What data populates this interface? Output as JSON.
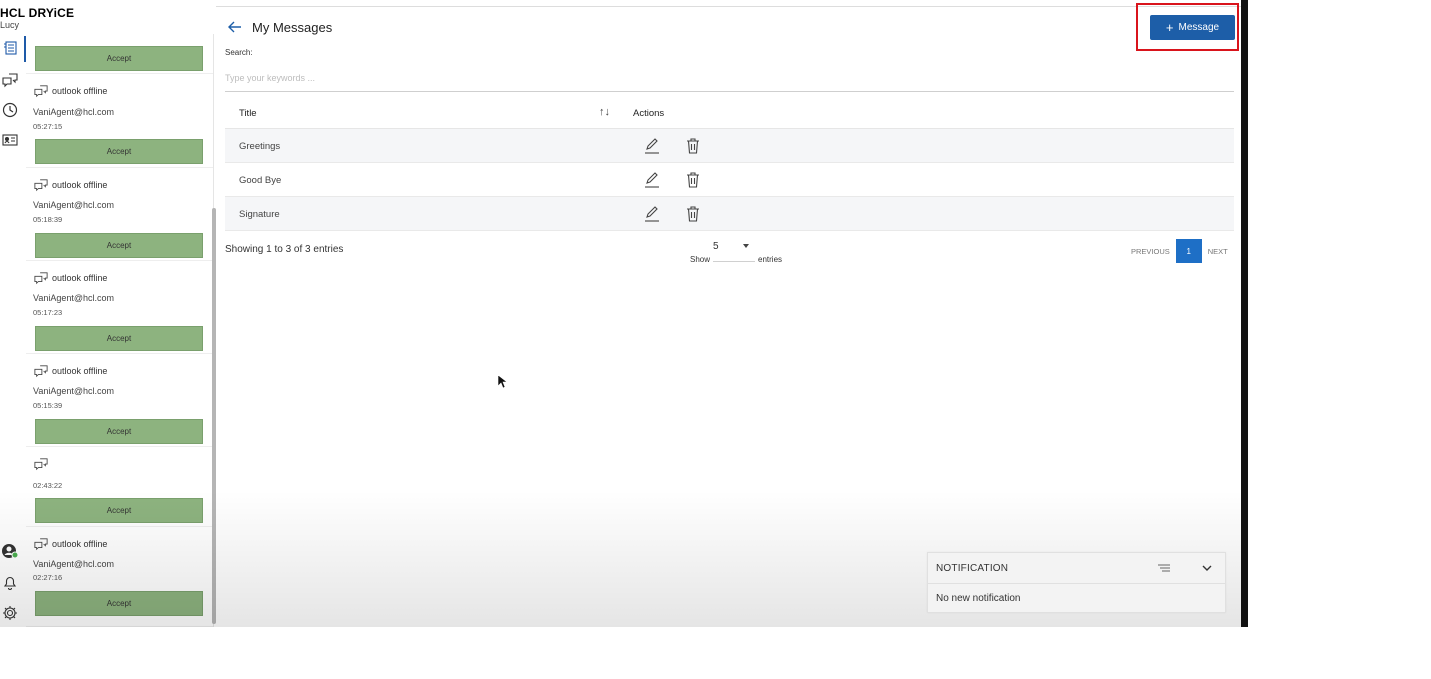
{
  "brand": {
    "logo_prefix": "HCL",
    "logo_name": "DRYiCE",
    "user_name": "Lucy"
  },
  "rail": {
    "icons": [
      "transcript-icon",
      "chat-icon",
      "history-icon",
      "contact-card-icon"
    ],
    "bottom_icons": [
      "user-status-icon",
      "bell-icon",
      "settings-icon"
    ]
  },
  "chats": [
    {
      "channel": "",
      "email": "",
      "time": "",
      "accept_label": "Accept"
    },
    {
      "channel": "outlook offline",
      "email": "VaniAgent@hcl.com",
      "time": "05:27:15",
      "accept_label": "Accept"
    },
    {
      "channel": "outlook offline",
      "email": "VaniAgent@hcl.com",
      "time": "05:18:39",
      "accept_label": "Accept"
    },
    {
      "channel": "outlook offline",
      "email": "VaniAgent@hcl.com",
      "time": "05:17:23",
      "accept_label": "Accept"
    },
    {
      "channel": "outlook offline",
      "email": "VaniAgent@hcl.com",
      "time": "05:15:39",
      "accept_label": "Accept"
    },
    {
      "channel": "",
      "email": "",
      "time": "02:43:22",
      "accept_label": "Accept"
    },
    {
      "channel": "outlook offline",
      "email": "VaniAgent@hcl.com",
      "time": "02:27:16",
      "accept_label": "Accept"
    }
  ],
  "main": {
    "title": "My Messages",
    "add_button_label": "Message",
    "search_label": "Search:",
    "search_placeholder": "Type your keywords ...",
    "columns": {
      "title": "Title",
      "sort": "↑↓",
      "actions": "Actions"
    },
    "rows": [
      {
        "title": "Greetings"
      },
      {
        "title": "Good Bye"
      },
      {
        "title": "Signature"
      }
    ],
    "entries_info": "Showing 1 to 3 of 3 entries",
    "show_label": "Show",
    "show_value": "5",
    "entries_label": "entries",
    "pager": {
      "previous": "PREVIOUS",
      "current": "1",
      "next": "NEXT"
    }
  },
  "notification": {
    "title": "NOTIFICATION",
    "body": "No new notification"
  },
  "colors": {
    "accent_blue": "#1d5ea8",
    "accept_green": "#8db37f",
    "highlight_red": "#d9141c"
  }
}
